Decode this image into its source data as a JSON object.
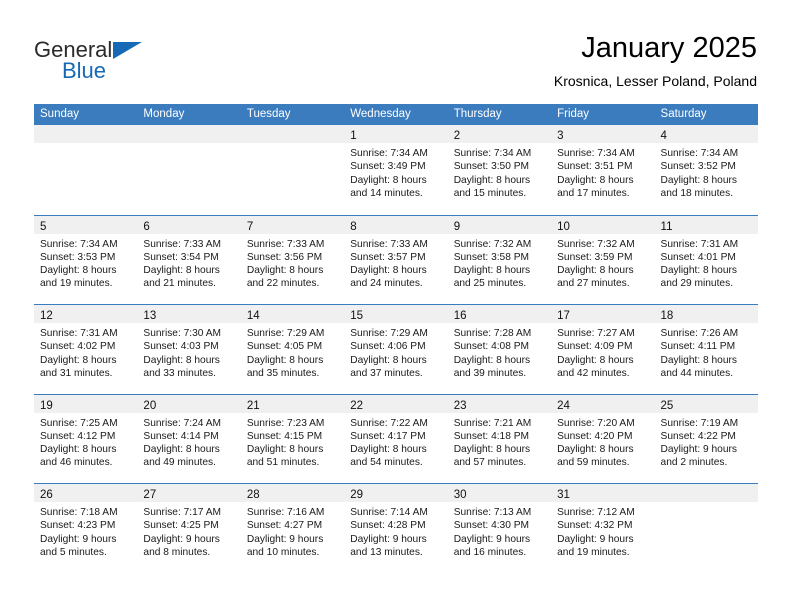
{
  "brand": {
    "name_top": "General",
    "name_bottom": "Blue",
    "triangle_icon": "brand-triangle-icon",
    "colors": {
      "blue": "#1669b5",
      "dark": "#2b2b2b"
    }
  },
  "header": {
    "title": "January 2025",
    "subtitle": "Krosnica, Lesser Poland, Poland"
  },
  "theme": {
    "header_band": "#3b7cbf",
    "row_divider": "#3b7cbf",
    "daynum_band": "#f0f0f0",
    "page_background": "#ffffff"
  },
  "weekdays": [
    "Sunday",
    "Monday",
    "Tuesday",
    "Wednesday",
    "Thursday",
    "Friday",
    "Saturday"
  ],
  "weeks": [
    [
      {
        "day": "",
        "lines": []
      },
      {
        "day": "",
        "lines": []
      },
      {
        "day": "",
        "lines": []
      },
      {
        "day": "1",
        "lines": [
          "Sunrise: 7:34 AM",
          "Sunset: 3:49 PM",
          "Daylight: 8 hours",
          "and 14 minutes."
        ]
      },
      {
        "day": "2",
        "lines": [
          "Sunrise: 7:34 AM",
          "Sunset: 3:50 PM",
          "Daylight: 8 hours",
          "and 15 minutes."
        ]
      },
      {
        "day": "3",
        "lines": [
          "Sunrise: 7:34 AM",
          "Sunset: 3:51 PM",
          "Daylight: 8 hours",
          "and 17 minutes."
        ]
      },
      {
        "day": "4",
        "lines": [
          "Sunrise: 7:34 AM",
          "Sunset: 3:52 PM",
          "Daylight: 8 hours",
          "and 18 minutes."
        ]
      }
    ],
    [
      {
        "day": "5",
        "lines": [
          "Sunrise: 7:34 AM",
          "Sunset: 3:53 PM",
          "Daylight: 8 hours",
          "and 19 minutes."
        ]
      },
      {
        "day": "6",
        "lines": [
          "Sunrise: 7:33 AM",
          "Sunset: 3:54 PM",
          "Daylight: 8 hours",
          "and 21 minutes."
        ]
      },
      {
        "day": "7",
        "lines": [
          "Sunrise: 7:33 AM",
          "Sunset: 3:56 PM",
          "Daylight: 8 hours",
          "and 22 minutes."
        ]
      },
      {
        "day": "8",
        "lines": [
          "Sunrise: 7:33 AM",
          "Sunset: 3:57 PM",
          "Daylight: 8 hours",
          "and 24 minutes."
        ]
      },
      {
        "day": "9",
        "lines": [
          "Sunrise: 7:32 AM",
          "Sunset: 3:58 PM",
          "Daylight: 8 hours",
          "and 25 minutes."
        ]
      },
      {
        "day": "10",
        "lines": [
          "Sunrise: 7:32 AM",
          "Sunset: 3:59 PM",
          "Daylight: 8 hours",
          "and 27 minutes."
        ]
      },
      {
        "day": "11",
        "lines": [
          "Sunrise: 7:31 AM",
          "Sunset: 4:01 PM",
          "Daylight: 8 hours",
          "and 29 minutes."
        ]
      }
    ],
    [
      {
        "day": "12",
        "lines": [
          "Sunrise: 7:31 AM",
          "Sunset: 4:02 PM",
          "Daylight: 8 hours",
          "and 31 minutes."
        ]
      },
      {
        "day": "13",
        "lines": [
          "Sunrise: 7:30 AM",
          "Sunset: 4:03 PM",
          "Daylight: 8 hours",
          "and 33 minutes."
        ]
      },
      {
        "day": "14",
        "lines": [
          "Sunrise: 7:29 AM",
          "Sunset: 4:05 PM",
          "Daylight: 8 hours",
          "and 35 minutes."
        ]
      },
      {
        "day": "15",
        "lines": [
          "Sunrise: 7:29 AM",
          "Sunset: 4:06 PM",
          "Daylight: 8 hours",
          "and 37 minutes."
        ]
      },
      {
        "day": "16",
        "lines": [
          "Sunrise: 7:28 AM",
          "Sunset: 4:08 PM",
          "Daylight: 8 hours",
          "and 39 minutes."
        ]
      },
      {
        "day": "17",
        "lines": [
          "Sunrise: 7:27 AM",
          "Sunset: 4:09 PM",
          "Daylight: 8 hours",
          "and 42 minutes."
        ]
      },
      {
        "day": "18",
        "lines": [
          "Sunrise: 7:26 AM",
          "Sunset: 4:11 PM",
          "Daylight: 8 hours",
          "and 44 minutes."
        ]
      }
    ],
    [
      {
        "day": "19",
        "lines": [
          "Sunrise: 7:25 AM",
          "Sunset: 4:12 PM",
          "Daylight: 8 hours",
          "and 46 minutes."
        ]
      },
      {
        "day": "20",
        "lines": [
          "Sunrise: 7:24 AM",
          "Sunset: 4:14 PM",
          "Daylight: 8 hours",
          "and 49 minutes."
        ]
      },
      {
        "day": "21",
        "lines": [
          "Sunrise: 7:23 AM",
          "Sunset: 4:15 PM",
          "Daylight: 8 hours",
          "and 51 minutes."
        ]
      },
      {
        "day": "22",
        "lines": [
          "Sunrise: 7:22 AM",
          "Sunset: 4:17 PM",
          "Daylight: 8 hours",
          "and 54 minutes."
        ]
      },
      {
        "day": "23",
        "lines": [
          "Sunrise: 7:21 AM",
          "Sunset: 4:18 PM",
          "Daylight: 8 hours",
          "and 57 minutes."
        ]
      },
      {
        "day": "24",
        "lines": [
          "Sunrise: 7:20 AM",
          "Sunset: 4:20 PM",
          "Daylight: 8 hours",
          "and 59 minutes."
        ]
      },
      {
        "day": "25",
        "lines": [
          "Sunrise: 7:19 AM",
          "Sunset: 4:22 PM",
          "Daylight: 9 hours",
          "and 2 minutes."
        ]
      }
    ],
    [
      {
        "day": "26",
        "lines": [
          "Sunrise: 7:18 AM",
          "Sunset: 4:23 PM",
          "Daylight: 9 hours",
          "and 5 minutes."
        ]
      },
      {
        "day": "27",
        "lines": [
          "Sunrise: 7:17 AM",
          "Sunset: 4:25 PM",
          "Daylight: 9 hours",
          "and 8 minutes."
        ]
      },
      {
        "day": "28",
        "lines": [
          "Sunrise: 7:16 AM",
          "Sunset: 4:27 PM",
          "Daylight: 9 hours",
          "and 10 minutes."
        ]
      },
      {
        "day": "29",
        "lines": [
          "Sunrise: 7:14 AM",
          "Sunset: 4:28 PM",
          "Daylight: 9 hours",
          "and 13 minutes."
        ]
      },
      {
        "day": "30",
        "lines": [
          "Sunrise: 7:13 AM",
          "Sunset: 4:30 PM",
          "Daylight: 9 hours",
          "and 16 minutes."
        ]
      },
      {
        "day": "31",
        "lines": [
          "Sunrise: 7:12 AM",
          "Sunset: 4:32 PM",
          "Daylight: 9 hours",
          "and 19 minutes."
        ]
      },
      {
        "day": "",
        "lines": []
      }
    ]
  ]
}
